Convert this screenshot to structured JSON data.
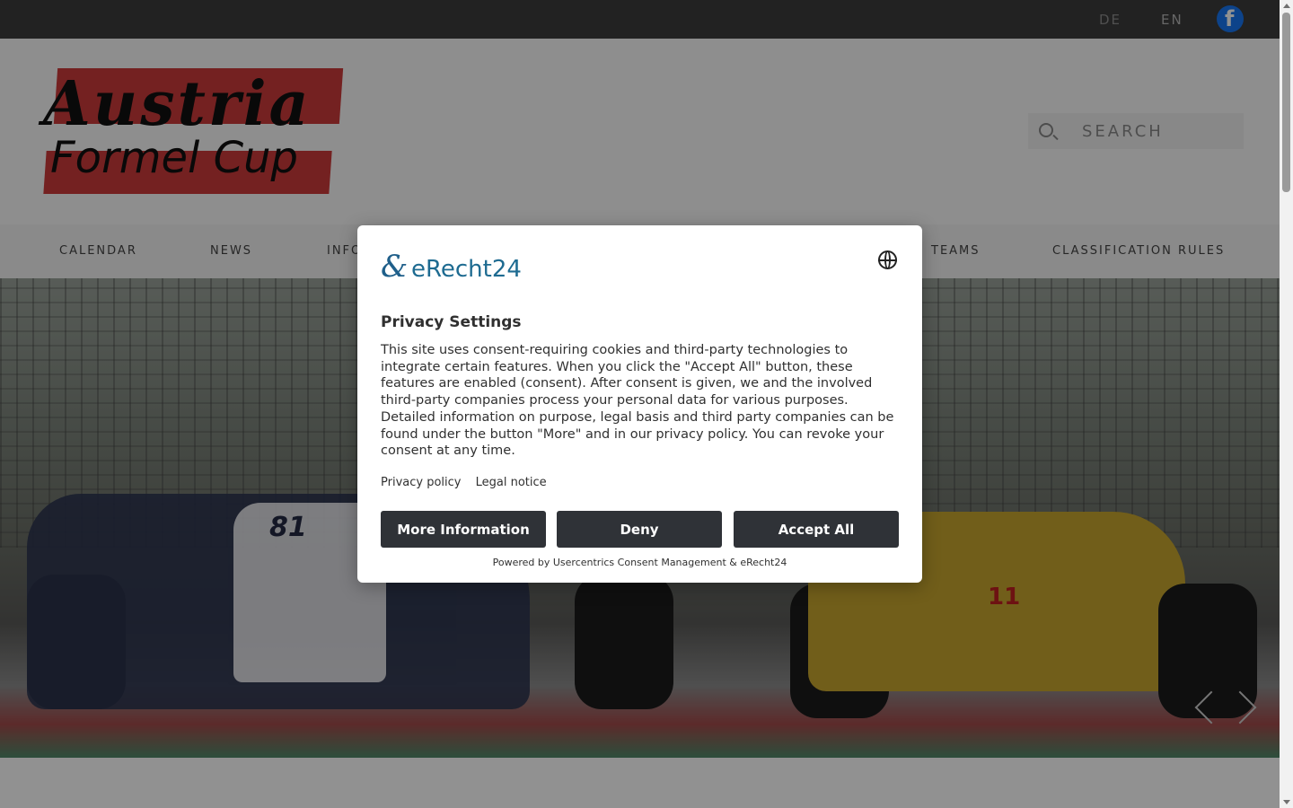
{
  "topbar": {
    "languages": [
      "DE",
      "EN"
    ],
    "facebook_icon": "facebook-icon",
    "facebook_color": "#1877f2"
  },
  "header": {
    "logo_line1": "Austria",
    "logo_line2": "Formel Cup",
    "logo_accent": "#cc3b3b",
    "search_placeholder": "SEARCH"
  },
  "nav": {
    "items": [
      "CALENDAR",
      "NEWS",
      "INFO",
      "TEAMS",
      "CLASSIFICATION RULES"
    ]
  },
  "hero": {
    "car_number_left": "81",
    "car_number_right": "11",
    "prev_icon": "chevron-left-icon",
    "next_icon": "chevron-right-icon"
  },
  "consent": {
    "brand": "eRecht24",
    "title": "Privacy Settings",
    "description": "This site uses consent-requiring cookies and third-party technologies to integrate certain features. When you click the \"Accept All\" button, these features are enabled (consent). After consent is given, we and the involved third-party companies process your personal data for various purposes. Detailed information on purpose, legal basis and third party companies can be found under the button \"More\" and in our privacy policy. You can revoke your consent at any time.",
    "links": {
      "privacy_policy": "Privacy policy",
      "legal_notice": "Legal notice"
    },
    "buttons": {
      "more": "More Information",
      "deny": "Deny",
      "accept": "Accept All"
    },
    "powered_by": "Powered by Usercentrics Consent Management & eRecht24",
    "button_color": "#2f3237"
  }
}
